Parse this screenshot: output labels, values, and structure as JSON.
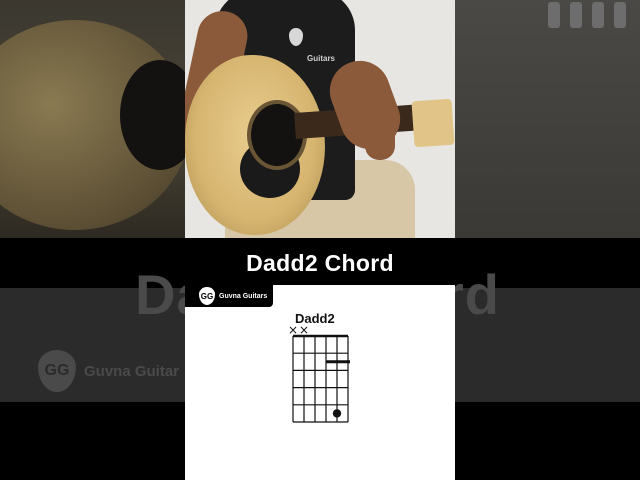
{
  "title": "Dadd2 Chord",
  "brand": {
    "name": "Guvna Guitars",
    "logo_letters": "GG"
  },
  "shirt_text": "Guitars",
  "diagram": {
    "chord_name": "Dadd2",
    "muted_marker": "×",
    "strings": 6,
    "frets": 5,
    "muted_strings": [
      1,
      2
    ],
    "barre": {
      "fret": 2,
      "from_string": 4,
      "to_string": 6
    },
    "dots": [
      {
        "string": 5,
        "fret": 5
      }
    ]
  },
  "background": {
    "ghost_title_left": "Da",
    "ghost_title_right": "rd",
    "ghost_brand": "Guvna Guitar",
    "ghost_logo_letters": "GG"
  },
  "colors": {
    "title_text": "#ffffff",
    "card_bg": "#ffffff",
    "strip_bg": "#000000",
    "grid": "#111111"
  }
}
